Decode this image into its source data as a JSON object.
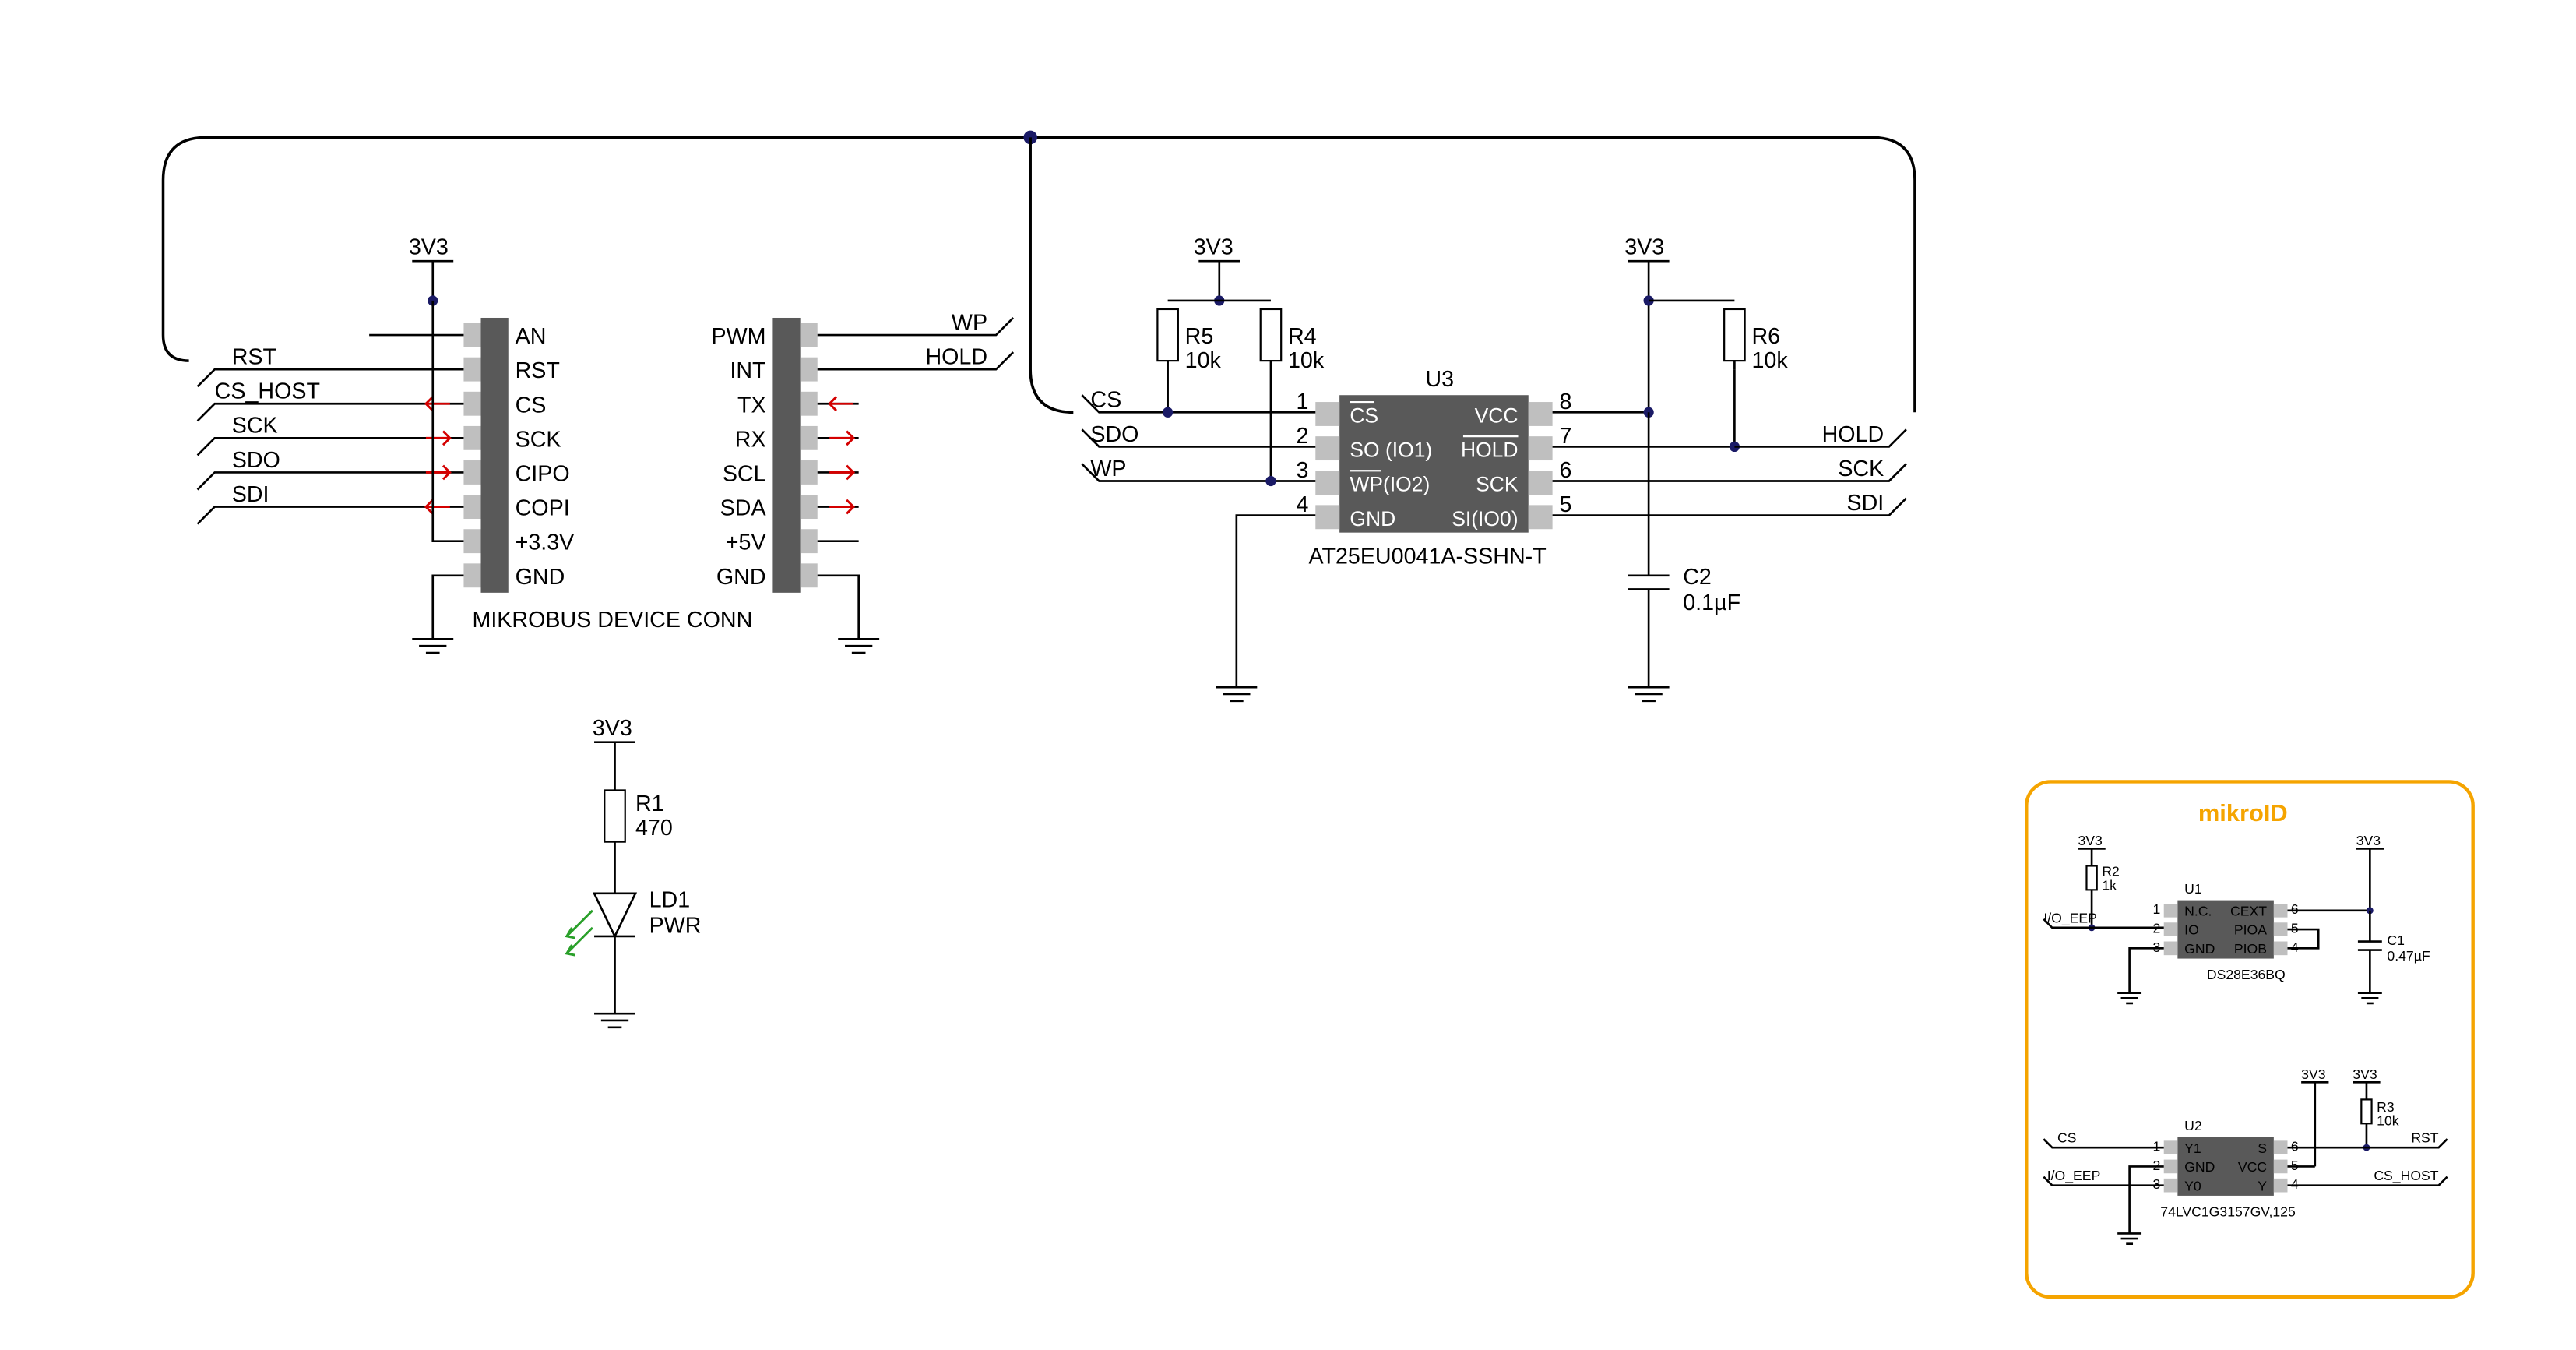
{
  "power": {
    "v33": "3V3",
    "gnd": "GND"
  },
  "mikrobus": {
    "title": "MIKROBUS DEVICE CONN",
    "left_net": [
      "",
      "RST",
      "CS_HOST",
      "SCK",
      "SDO",
      "SDI",
      "",
      ""
    ],
    "left_pins": [
      "AN",
      "RST",
      "CS",
      "SCK",
      "CIPO",
      "COPI",
      "+3.3V",
      "GND"
    ],
    "right_pins": [
      "PWM",
      "INT",
      "TX",
      "RX",
      "SCL",
      "SDA",
      "+5V",
      "GND"
    ],
    "right_net": [
      "WP",
      "HOLD",
      "",
      "",
      "",
      "",
      "",
      ""
    ]
  },
  "u3": {
    "ref": "U3",
    "part": "AT25EU0041A-SSHN-T",
    "left_pins": [
      {
        "num": "1",
        "name": "CS",
        "net": "CS",
        "bar": true
      },
      {
        "num": "2",
        "name": "SO (IO1)",
        "net": "SDO"
      },
      {
        "num": "3",
        "name": "WP(IO2)",
        "net": "WP",
        "bar": true
      },
      {
        "num": "4",
        "name": "GND",
        "net": ""
      }
    ],
    "right_pins": [
      {
        "num": "8",
        "name": "VCC",
        "net": ""
      },
      {
        "num": "7",
        "name": "HOLD",
        "net": "HOLD",
        "bar": true
      },
      {
        "num": "6",
        "name": "SCK",
        "net": "SCK"
      },
      {
        "num": "5",
        "name": "SI(IO0)",
        "net": "SDI"
      }
    ]
  },
  "r1": {
    "ref": "R1",
    "val": "470"
  },
  "r4": {
    "ref": "R4",
    "val": "10k"
  },
  "r5": {
    "ref": "R5",
    "val": "10k"
  },
  "r6": {
    "ref": "R6",
    "val": "10k"
  },
  "c2": {
    "ref": "C2",
    "val": "0.1µF"
  },
  "ld1": {
    "ref": "LD1",
    "val": "PWR"
  },
  "mikroid": {
    "title": "mikroID",
    "u1": {
      "ref": "U1",
      "part": "DS28E36BQ",
      "left": [
        "N.C.",
        "IO",
        "GND"
      ],
      "right": [
        "CEXT",
        "PIOA",
        "PIOB"
      ],
      "lnum": [
        "1",
        "2",
        "3"
      ],
      "rnum": [
        "6",
        "5",
        "4"
      ]
    },
    "u2": {
      "ref": "U2",
      "part": "74LVC1G3157GV,125",
      "left": [
        "Y1",
        "GND",
        "Y0"
      ],
      "right": [
        "S",
        "VCC",
        "Y"
      ],
      "lnum": [
        "1",
        "2",
        "3"
      ],
      "rnum": [
        "6",
        "5",
        "4"
      ]
    },
    "r2": {
      "ref": "R2",
      "val": "1k"
    },
    "r3": {
      "ref": "R3",
      "val": "10k"
    },
    "c1": {
      "ref": "C1",
      "val": "0.47µF"
    },
    "nets": {
      "io_eep": "I/O_EEP",
      "cs": "CS",
      "rst": "RST",
      "cs_host": "CS_HOST"
    }
  }
}
